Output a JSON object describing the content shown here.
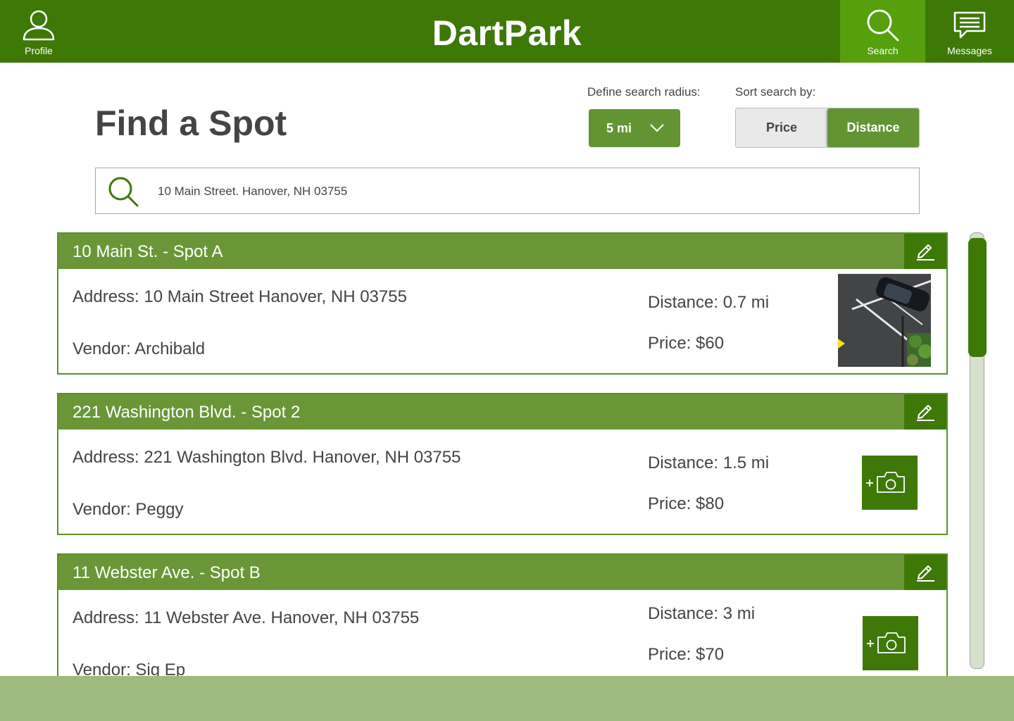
{
  "app": {
    "title": "DartPark",
    "colors": {
      "nav_dark": "#3e7807",
      "nav_active": "#55a00c",
      "card_header": "#6a9638",
      "accent": "#639434",
      "bottom_bar": "#9fba7f"
    }
  },
  "nav": {
    "profile": {
      "label": "Profile",
      "icon": "user-icon"
    },
    "search": {
      "label": "Search",
      "icon": "search-icon",
      "active": true
    },
    "messages": {
      "label": "Messages",
      "icon": "chat-icon"
    }
  },
  "page": {
    "title": "Find a Spot"
  },
  "filters": {
    "radius_label": "Define search radius:",
    "radius_value": "5 mi",
    "sort_label": "Sort search by:",
    "sort_options": [
      "Price",
      "Distance"
    ],
    "sort_selected": "Distance"
  },
  "search": {
    "value": "10 Main Street. Hanover, NH 03755",
    "icon": "search-icon"
  },
  "listings": [
    {
      "title": "10 Main St. - Spot A",
      "address": "Address: 10 Main Street Hanover, NH 03755",
      "vendor": "Vendor: Archibald",
      "distance": "Distance: 0.7 mi",
      "price": "Price: $60",
      "photo": "parking-lot-photo"
    },
    {
      "title": "221 Washington Blvd. - Spot 2",
      "address": "Address: 221 Washington Blvd. Hanover, NH 03755",
      "vendor": "Vendor: Peggy",
      "distance": "Distance: 1.5 mi",
      "price": "Price: $80",
      "photo": "add-photo-icon"
    },
    {
      "title": "11 Webster Ave. - Spot B",
      "address": "Address: 11 Webster Ave. Hanover, NH 03755",
      "vendor": "Vendor: Sig Ep",
      "distance": "Distance: 3 mi",
      "price": "Price: $70",
      "photo": "add-photo-icon"
    }
  ]
}
